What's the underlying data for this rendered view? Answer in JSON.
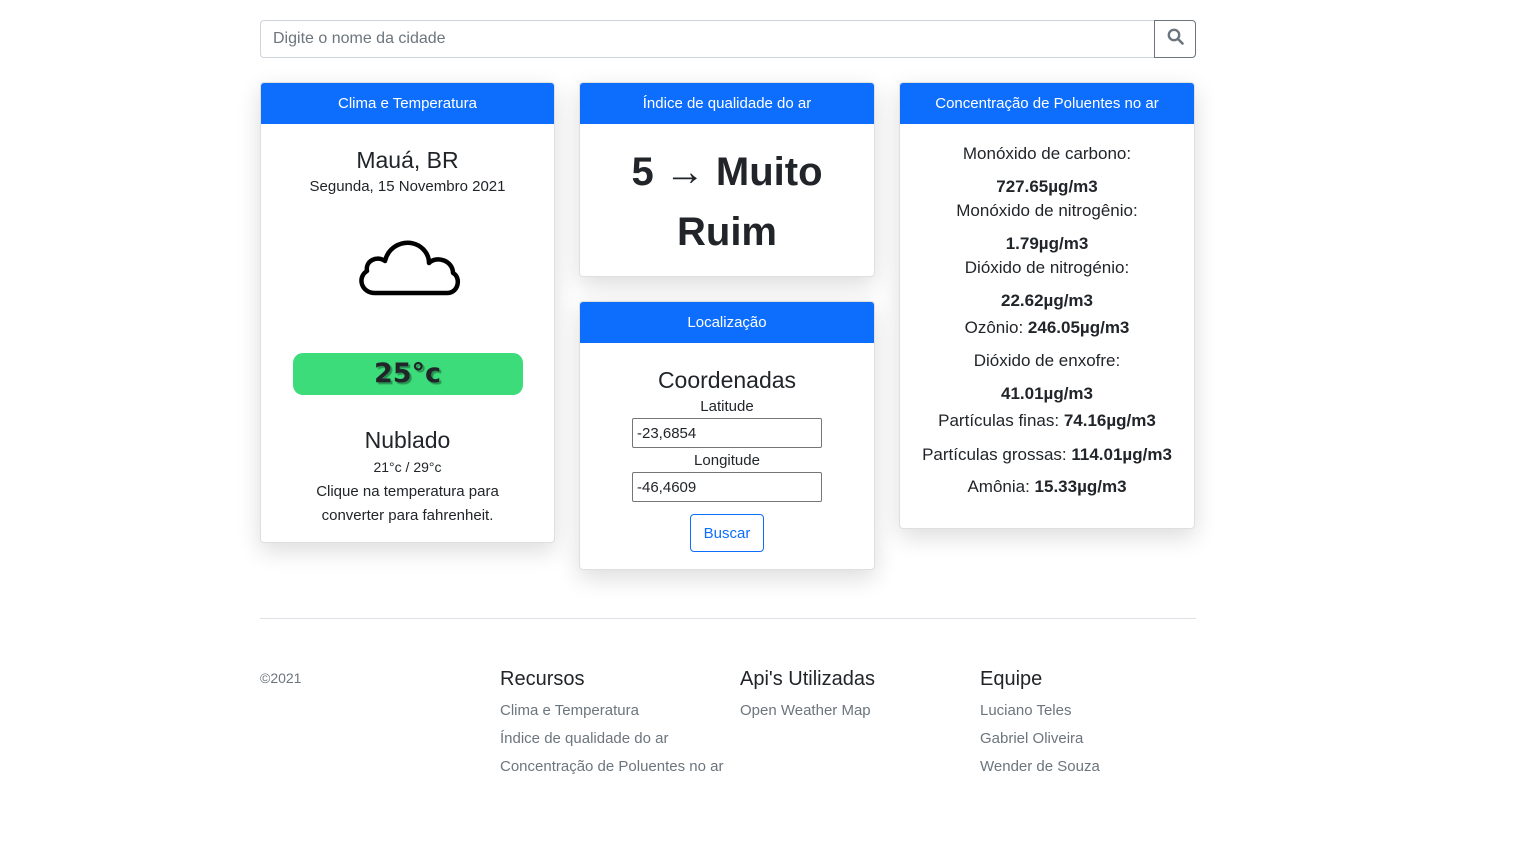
{
  "search": {
    "placeholder": "Digite o nome da cidade",
    "icon": "search-icon"
  },
  "clima": {
    "header": "Clima e Temperatura",
    "city": "Mauá, BR",
    "date": "Segunda, 15 Novembro 2021",
    "icon": "cloud-icon",
    "temperature": "25°c",
    "condition": "Nublado",
    "minmax": "21°c / 29°c",
    "hint": "Clique na temperatura para converter para fahrenheit."
  },
  "aqi": {
    "header": "Índice de qualidade do ar",
    "value": "5 → Muito Ruim"
  },
  "location": {
    "header": "Localização",
    "title": "Coordenadas",
    "latitude_label": "Latitude",
    "latitude_value": "-23,6854",
    "longitude_label": "Longitude",
    "longitude_value": "-46,4609",
    "button": "Buscar"
  },
  "pollutants": {
    "header": "Concentração de Poluentes no ar",
    "co_label": "Monóxido de carbono:",
    "co_value": "727.65µg/m3",
    "no_label": "Monóxido de nitrogênio:",
    "no_value": "1.79µg/m3",
    "no2_label": "Dióxido de nitrogénio:",
    "no2_value": "22.62µg/m3",
    "o3_label": "Ozônio:",
    "o3_value": "246.05µg/m3",
    "so2_label": "Dióxido de enxofre:",
    "so2_value": "41.01µg/m3",
    "pm25_label": "Partículas finas:",
    "pm25_value": "74.16µg/m3",
    "pm10_label": "Partículas grossas:",
    "pm10_value": "114.01µg/m3",
    "nh3_label": "Amônia:",
    "nh3_value": "15.33µg/m3"
  },
  "footer": {
    "copyright": "©2021",
    "recursos": {
      "title": "Recursos",
      "links": [
        "Clima e Temperatura",
        "Índice de qualidade do ar",
        "Concentração de Poluentes no ar"
      ]
    },
    "apis": {
      "title": "Api's Utilizadas",
      "links": [
        "Open Weather Map"
      ]
    },
    "equipe": {
      "title": "Equipe",
      "links": [
        "Luciano Teles",
        "Gabriel Oliveira",
        "Wender de Souza"
      ]
    }
  },
  "colors": {
    "primary": "#0d6efd",
    "temp_pill": "#3ddc7a",
    "muted": "#6c757d"
  }
}
